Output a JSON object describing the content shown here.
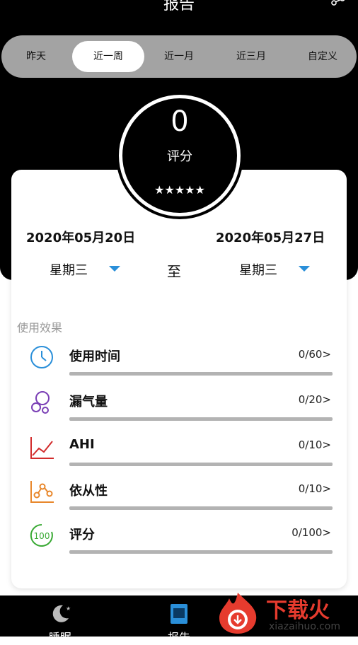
{
  "header": {
    "title": "报告"
  },
  "tabs": [
    {
      "label": "昨天"
    },
    {
      "label": "近一周"
    },
    {
      "label": "近一月"
    },
    {
      "label": "近三月"
    },
    {
      "label": "自定义"
    }
  ],
  "score": {
    "value": "0",
    "label": "评分",
    "stars": "★★★★★"
  },
  "date_range": {
    "start_date": "2020年05月20日",
    "end_date": "2020年05月27日",
    "start_weekday": "星期三",
    "end_weekday": "星期三",
    "separator": "至"
  },
  "effects": {
    "title": "使用效果",
    "items": [
      {
        "label": "使用时间",
        "value": "0/60>"
      },
      {
        "label": "漏气量",
        "value": "0/20>"
      },
      {
        "label": "AHI",
        "value": "0/10>"
      },
      {
        "label": "依从性",
        "value": "0/10>"
      },
      {
        "label": "评分",
        "value": "0/100>"
      }
    ]
  },
  "bottom_nav": [
    {
      "label": "睡眠",
      "icon": "moon-icon"
    },
    {
      "label": "报告",
      "icon": "report-icon"
    }
  ],
  "watermark": {
    "text": "下载火",
    "subtext": "xiazaihuo.com"
  },
  "colors": {
    "accent": "#2a8fd9",
    "tab_bg": "#a3a3a3",
    "watermark": "#e63b2e"
  }
}
